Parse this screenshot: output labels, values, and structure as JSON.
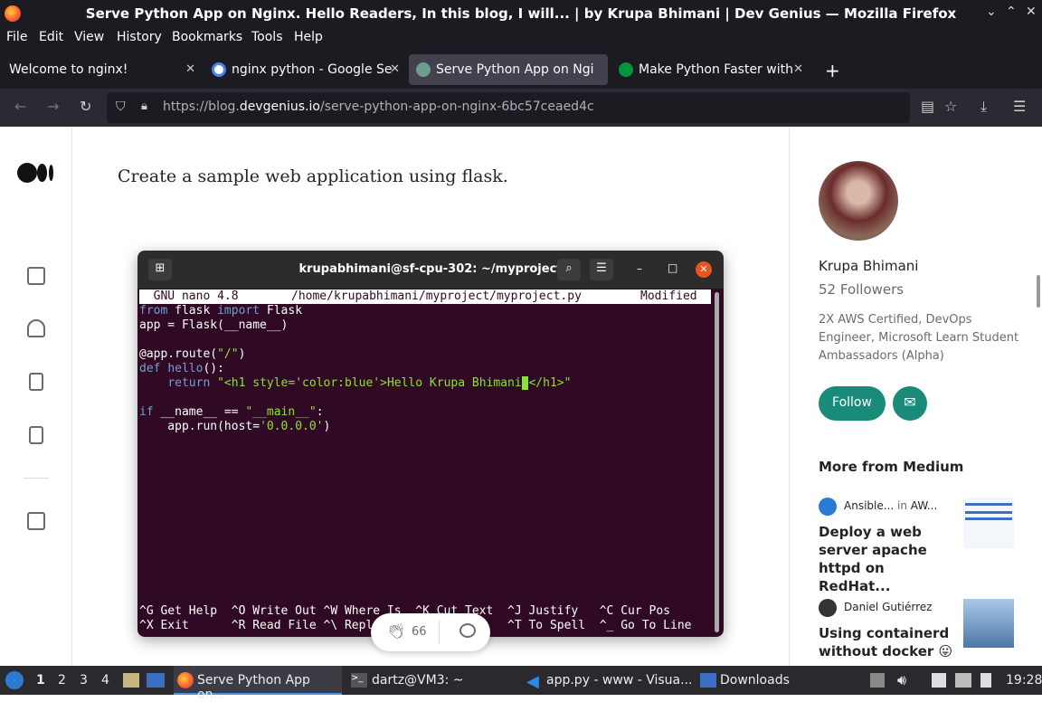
{
  "window": {
    "title": "Serve Python App on Nginx. Hello Readers, In this blog, I will... | by Krupa Bhimani | Dev Genius — Mozilla Firefox",
    "controls": [
      "⌄",
      "⌃",
      "✕"
    ]
  },
  "menu": [
    "File",
    "Edit",
    "View",
    "History",
    "Bookmarks",
    "Tools",
    "Help"
  ],
  "tabs": [
    {
      "label": "Welcome to nginx!",
      "icon": "none"
    },
    {
      "label": "nginx python - Google Se",
      "icon": "google-icon"
    },
    {
      "label": "Serve Python App on Ngi",
      "icon": "medium-icon",
      "active": true
    },
    {
      "label": "Make Python Faster with",
      "icon": "nginx-icon"
    }
  ],
  "url": {
    "prefix": "https://blog.",
    "domain": "devgenius.io",
    "path": "/serve-python-app-on-nginx-6bc57ceaed4c"
  },
  "article": {
    "text": "Create a sample web application using flask."
  },
  "terminal": {
    "title": "krupabhimani@sf-cpu-302: ~/myproject",
    "nano_header_left": "  GNU nano 4.8",
    "nano_header_path": "/home/krupabhimani/myproject/myproject.py",
    "nano_header_status": "Modified",
    "code": [
      {
        "parts": [
          [
            "kw",
            "from"
          ],
          [
            "t",
            " flask "
          ],
          [
            "kw",
            "import"
          ],
          [
            "t",
            " Flask"
          ]
        ]
      },
      {
        "parts": [
          [
            "t",
            "app = Flask(__name__)"
          ]
        ]
      },
      {
        "parts": [
          [
            "t",
            ""
          ]
        ]
      },
      {
        "parts": [
          [
            "t",
            "@app.route("
          ],
          [
            "str",
            "\"/\""
          ],
          [
            "t",
            ")"
          ]
        ]
      },
      {
        "parts": [
          [
            "kw",
            "def"
          ],
          [
            "t",
            " "
          ],
          [
            "kw",
            "hello"
          ],
          [
            "t",
            "():"
          ]
        ]
      },
      {
        "parts": [
          [
            "t",
            "    "
          ],
          [
            "kw",
            "return"
          ],
          [
            "t",
            " "
          ],
          [
            "str",
            "\"<h1 style='color:blue'>Hello Krupa Bhimani"
          ],
          [
            "t",
            "▮"
          ],
          [
            "str",
            "</h1>\""
          ]
        ]
      },
      {
        "parts": [
          [
            "t",
            ""
          ]
        ]
      },
      {
        "parts": [
          [
            "kw",
            "if"
          ],
          [
            "t",
            " __name__ == "
          ],
          [
            "str",
            "\"__main__\""
          ],
          [
            "t",
            ":"
          ]
        ]
      },
      {
        "parts": [
          [
            "t",
            "    app.run(host="
          ],
          [
            "str",
            "'0.0.0.0'"
          ],
          [
            "t",
            ")"
          ]
        ]
      }
    ],
    "shortcuts_row1": "^G Get Help  ^O Write Out ^W Where Is  ^K Cut Text  ^J Justify   ^C Cur Pos",
    "shortcuts_row2": "^X Exit      ^R Read File ^\\ Repl      ^U Paste     ^T To Spell  ^_ Go To Line"
  },
  "clap": {
    "count": "66"
  },
  "author": {
    "name": "Krupa Bhimani",
    "followers": "52 Followers",
    "bio": "2X AWS Certified, DevOps Engineer, Microsoft Learn Student Ambassadors (Alpha)",
    "follow_label": "Follow"
  },
  "more": {
    "heading": "More from Medium",
    "items": [
      {
        "author": "Ansible...",
        "in": "in",
        "pub": "AW...",
        "title": "Deploy a web server apache httpd on RedHat..."
      },
      {
        "author": "Daniel Gutiérrez",
        "title": "Using containerd without docker 😛"
      }
    ]
  },
  "taskbar": {
    "workspaces": [
      "1",
      "2",
      "3",
      "4"
    ],
    "apps": [
      "Serve Python App on...",
      "dartz@VM3: ~",
      "app.py - www - Visua...",
      "Downloads"
    ],
    "clock": "19:28"
  }
}
